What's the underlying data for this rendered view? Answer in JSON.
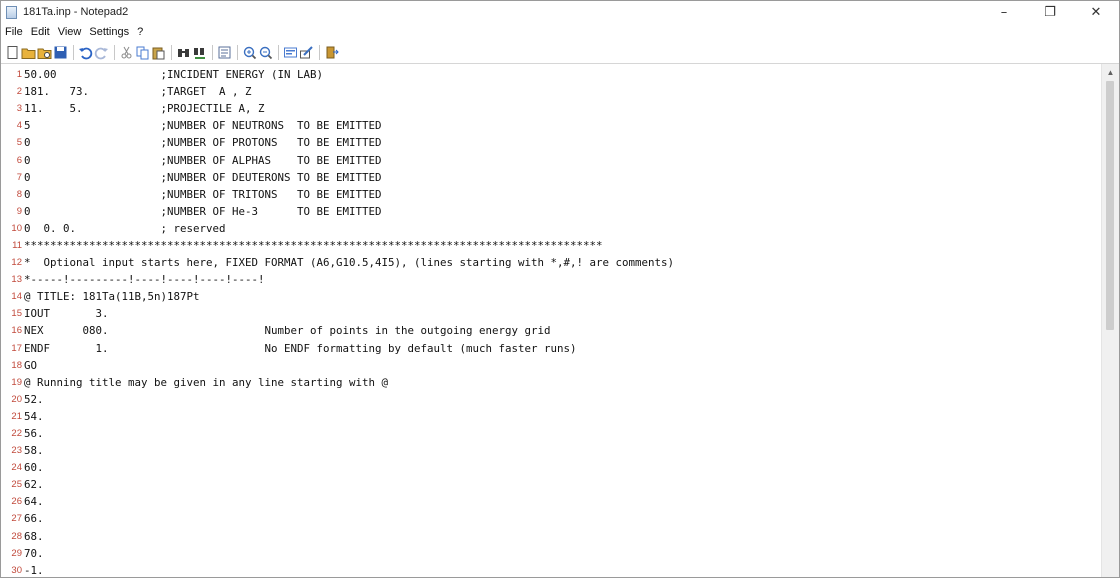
{
  "window": {
    "title": "181Ta.inp - Notepad2",
    "minimize": "–",
    "maximize": "❐",
    "close": "✕"
  },
  "menu": [
    "File",
    "Edit",
    "View",
    "Settings",
    "?"
  ],
  "toolbar": {
    "buttons": [
      {
        "name": "new-file-icon",
        "color": "#ffffff"
      },
      {
        "name": "open-folder-icon",
        "color": "#e8b23c"
      },
      {
        "name": "browse-icon",
        "color": "#e8b23c"
      },
      {
        "name": "save-icon",
        "color": "#2f5fb3"
      },
      {
        "name": "separator"
      },
      {
        "name": "undo-icon",
        "color": "#2a63c5"
      },
      {
        "name": "redo-icon",
        "color": "#a9b8d8"
      },
      {
        "name": "separator"
      },
      {
        "name": "cut-icon",
        "color": "#8a8a8a"
      },
      {
        "name": "copy-icon",
        "color": "#4a7bd0"
      },
      {
        "name": "paste-icon",
        "color": "#c9a44a"
      },
      {
        "name": "separator"
      },
      {
        "name": "find-icon",
        "color": "#3a3a3a"
      },
      {
        "name": "replace-icon",
        "color": "#3f8f3f"
      },
      {
        "name": "separator"
      },
      {
        "name": "word-wrap-icon",
        "color": "#5a6f9a"
      },
      {
        "name": "separator"
      },
      {
        "name": "zoom-in-icon",
        "color": "#3a6fc0"
      },
      {
        "name": "zoom-out-icon",
        "color": "#3a6fc0"
      },
      {
        "name": "separator"
      },
      {
        "name": "scheme-icon",
        "color": "#4a7bd0"
      },
      {
        "name": "customize-scheme-icon",
        "color": "#3a6fc0"
      },
      {
        "name": "separator"
      },
      {
        "name": "exit-icon",
        "color": "#c89632"
      }
    ]
  },
  "editor": {
    "lines": [
      {
        "num": "1",
        "text": "50.00                ;INCIDENT ENERGY (IN LAB)"
      },
      {
        "num": "2",
        "text": "181.   73.           ;TARGET  A , Z"
      },
      {
        "num": "3",
        "text": "11.    5.            ;PROJECTILE A, Z"
      },
      {
        "num": "4",
        "text": "5                    ;NUMBER OF NEUTRONS  TO BE EMITTED"
      },
      {
        "num": "5",
        "text": "0                    ;NUMBER OF PROTONS   TO BE EMITTED"
      },
      {
        "num": "6",
        "text": "0                    ;NUMBER OF ALPHAS    TO BE EMITTED"
      },
      {
        "num": "7",
        "text": "0                    ;NUMBER OF DEUTERONS TO BE EMITTED"
      },
      {
        "num": "8",
        "text": "0                    ;NUMBER OF TRITONS   TO BE EMITTED"
      },
      {
        "num": "9",
        "text": "0                    ;NUMBER OF He-3      TO BE EMITTED"
      },
      {
        "num": "10",
        "text": "0  0. 0.             ; reserved"
      },
      {
        "num": "11",
        "text": "*****************************************************************************************"
      },
      {
        "num": "12",
        "text": "*  Optional input starts here, FIXED FORMAT (A6,G10.5,4I5), (lines starting with *,#,! are comments)"
      },
      {
        "num": "13",
        "text": "*-----!---------!----!----!----!----!"
      },
      {
        "num": "14",
        "text": "@ TITLE: 181Ta(11B,5n)187Pt"
      },
      {
        "num": "15",
        "text": "IOUT       3."
      },
      {
        "num": "16",
        "text": "NEX      080.                        Number of points in the outgoing energy grid"
      },
      {
        "num": "17",
        "text": "ENDF       1.                        No ENDF formatting by default (much faster runs)"
      },
      {
        "num": "18",
        "text": "GO"
      },
      {
        "num": "19",
        "text": "@ Running title may be given in any line starting with @"
      },
      {
        "num": "20",
        "text": "52."
      },
      {
        "num": "21",
        "text": "54."
      },
      {
        "num": "22",
        "text": "56."
      },
      {
        "num": "23",
        "text": "58."
      },
      {
        "num": "24",
        "text": "60."
      },
      {
        "num": "25",
        "text": "62."
      },
      {
        "num": "26",
        "text": "64."
      },
      {
        "num": "27",
        "text": "66."
      },
      {
        "num": "28",
        "text": "68."
      },
      {
        "num": "29",
        "text": "70."
      },
      {
        "num": "30",
        "text": "-1."
      }
    ]
  },
  "scrollbar": {
    "up_arrow": "▲",
    "thumb_position": 0.0,
    "thumb_fraction": 0.52
  }
}
